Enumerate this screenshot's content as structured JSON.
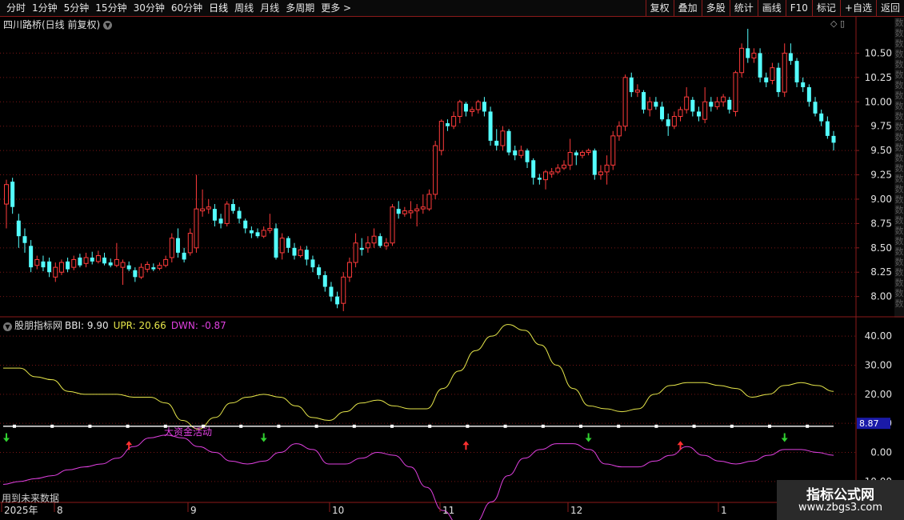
{
  "toolbar": {
    "periods": [
      "分时",
      "1分钟",
      "5分钟",
      "15分钟",
      "30分钟",
      "60分钟",
      "日线",
      "周线",
      "月线",
      "多周期",
      "更多 >"
    ],
    "active_period": "日线",
    "buttons": [
      "复权",
      "叠加",
      "多股",
      "统计",
      "画线",
      "F10",
      "标记",
      "+自选",
      "返回"
    ]
  },
  "chart": {
    "title": "四川路桥(日线 前复权)",
    "price_ticks": [
      "10.50",
      "10.25",
      "10.00",
      "9.75",
      "9.50",
      "9.25",
      "9.00",
      "8.75",
      "8.50",
      "8.25",
      "8.00"
    ],
    "price_range": [
      7.8,
      10.75
    ]
  },
  "indicator": {
    "name": "股朋指标网",
    "bbi_label": "BBI: 9.90",
    "upr_label": "UPR: 20.66",
    "dwn_label": "DWN: -0.87",
    "ticks": [
      "40.00",
      "30.00",
      "20.00",
      "10.00",
      "0.00",
      "-10.00"
    ],
    "range": [
      -15,
      45
    ],
    "current_value": "8.87",
    "annotation": "大资金活动",
    "colors": {
      "upr": "#e6e64a",
      "dwn": "#e040e0",
      "bbi": "#ffffff",
      "up_arrow": "#ff3030",
      "down_arrow": "#30d030"
    }
  },
  "time_axis": [
    "2025年",
    "8",
    "9",
    "10",
    "11",
    "12",
    "1"
  ],
  "bottom_note": "用到未来数据",
  "watermark": {
    "line1": "指标公式网",
    "line2": "www.zbgs3.com"
  },
  "candles": [
    {
      "o": 8.95,
      "c": 9.15,
      "h": 9.2,
      "l": 8.7
    },
    {
      "o": 9.18,
      "c": 8.92,
      "h": 9.22,
      "l": 8.85
    },
    {
      "o": 8.78,
      "c": 8.62,
      "h": 8.85,
      "l": 8.5
    },
    {
      "o": 8.62,
      "c": 8.55,
      "h": 8.7,
      "l": 8.45
    },
    {
      "o": 8.52,
      "c": 8.3,
      "h": 8.58,
      "l": 8.25
    },
    {
      "o": 8.32,
      "c": 8.38,
      "h": 8.42,
      "l": 8.28
    },
    {
      "o": 8.36,
      "c": 8.3,
      "h": 8.42,
      "l": 8.26
    },
    {
      "o": 8.36,
      "c": 8.25,
      "h": 8.4,
      "l": 8.2
    },
    {
      "o": 8.2,
      "c": 8.3,
      "h": 8.35,
      "l": 8.15
    },
    {
      "o": 8.25,
      "c": 8.35,
      "h": 8.38,
      "l": 8.22
    },
    {
      "o": 8.36,
      "c": 8.28,
      "h": 8.4,
      "l": 8.25
    },
    {
      "o": 8.3,
      "c": 8.38,
      "h": 8.42,
      "l": 8.27
    },
    {
      "o": 8.4,
      "c": 8.32,
      "h": 8.44,
      "l": 8.3
    },
    {
      "o": 8.34,
      "c": 8.4,
      "h": 8.45,
      "l": 8.3
    },
    {
      "o": 8.4,
      "c": 8.36,
      "h": 8.46,
      "l": 8.33
    },
    {
      "o": 8.36,
      "c": 8.42,
      "h": 8.47,
      "l": 8.34
    },
    {
      "o": 8.4,
      "c": 8.34,
      "h": 8.45,
      "l": 8.32
    },
    {
      "o": 8.35,
      "c": 8.32,
      "h": 8.39,
      "l": 8.3
    },
    {
      "o": 8.32,
      "c": 8.38,
      "h": 8.55,
      "l": 8.3
    },
    {
      "o": 8.3,
      "c": 8.35,
      "h": 8.38,
      "l": 8.12
    },
    {
      "o": 8.32,
      "c": 8.28,
      "h": 8.36,
      "l": 8.26
    },
    {
      "o": 8.27,
      "c": 8.2,
      "h": 8.3,
      "l": 8.15
    },
    {
      "o": 8.2,
      "c": 8.3,
      "h": 8.34,
      "l": 8.18
    },
    {
      "o": 8.28,
      "c": 8.33,
      "h": 8.36,
      "l": 8.25
    },
    {
      "o": 8.3,
      "c": 8.28,
      "h": 8.34,
      "l": 8.26
    },
    {
      "o": 8.29,
      "c": 8.32,
      "h": 8.35,
      "l": 8.27
    },
    {
      "o": 8.32,
      "c": 8.38,
      "h": 8.42,
      "l": 8.3
    },
    {
      "o": 8.4,
      "c": 8.6,
      "h": 8.65,
      "l": 8.35
    },
    {
      "o": 8.6,
      "c": 8.45,
      "h": 8.7,
      "l": 8.4
    },
    {
      "o": 8.45,
      "c": 8.38,
      "h": 8.5,
      "l": 8.35
    },
    {
      "o": 8.45,
      "c": 8.65,
      "h": 8.7,
      "l": 8.42
    },
    {
      "o": 8.5,
      "c": 8.9,
      "h": 9.25,
      "l": 8.45
    },
    {
      "o": 8.88,
      "c": 8.9,
      "h": 9.1,
      "l": 8.82
    },
    {
      "o": 8.9,
      "c": 8.92,
      "h": 9.0,
      "l": 8.85
    },
    {
      "o": 8.9,
      "c": 8.78,
      "h": 8.95,
      "l": 8.72
    },
    {
      "o": 8.8,
      "c": 8.75,
      "h": 8.85,
      "l": 8.7
    },
    {
      "o": 8.75,
      "c": 8.95,
      "h": 8.98,
      "l": 8.72
    },
    {
      "o": 8.95,
      "c": 8.88,
      "h": 9.0,
      "l": 8.85
    },
    {
      "o": 8.88,
      "c": 8.8,
      "h": 8.92,
      "l": 8.75
    },
    {
      "o": 8.78,
      "c": 8.7,
      "h": 8.8,
      "l": 8.65
    },
    {
      "o": 8.68,
      "c": 8.65,
      "h": 8.72,
      "l": 8.6
    },
    {
      "o": 8.66,
      "c": 8.62,
      "h": 8.7,
      "l": 8.6
    },
    {
      "o": 8.62,
      "c": 8.68,
      "h": 8.72,
      "l": 8.6
    },
    {
      "o": 8.68,
      "c": 8.7,
      "h": 8.85,
      "l": 8.65
    },
    {
      "o": 8.7,
      "c": 8.4,
      "h": 8.75,
      "l": 8.38
    },
    {
      "o": 8.45,
      "c": 8.6,
      "h": 8.65,
      "l": 8.38
    },
    {
      "o": 8.6,
      "c": 8.5,
      "h": 8.62,
      "l": 8.45
    },
    {
      "o": 8.5,
      "c": 8.42,
      "h": 8.55,
      "l": 8.38
    },
    {
      "o": 8.42,
      "c": 8.48,
      "h": 8.52,
      "l": 8.4
    },
    {
      "o": 8.48,
      "c": 8.38,
      "h": 8.52,
      "l": 8.32
    },
    {
      "o": 8.38,
      "c": 8.3,
      "h": 8.42,
      "l": 8.25
    },
    {
      "o": 8.3,
      "c": 8.22,
      "h": 8.33,
      "l": 8.18
    },
    {
      "o": 8.22,
      "c": 8.1,
      "h": 8.26,
      "l": 8.05
    },
    {
      "o": 8.1,
      "c": 8.0,
      "h": 8.15,
      "l": 7.95
    },
    {
      "o": 8.0,
      "c": 7.92,
      "h": 8.05,
      "l": 7.88
    },
    {
      "o": 7.93,
      "c": 8.2,
      "h": 8.25,
      "l": 7.85
    },
    {
      "o": 8.2,
      "c": 8.35,
      "h": 8.4,
      "l": 8.15
    },
    {
      "o": 8.35,
      "c": 8.55,
      "h": 8.65,
      "l": 8.3
    },
    {
      "o": 8.5,
      "c": 8.48,
      "h": 8.6,
      "l": 8.42
    },
    {
      "o": 8.5,
      "c": 8.55,
      "h": 8.62,
      "l": 8.45
    },
    {
      "o": 8.55,
      "c": 8.62,
      "h": 8.7,
      "l": 8.5
    },
    {
      "o": 8.62,
      "c": 8.52,
      "h": 8.65,
      "l": 8.5
    },
    {
      "o": 8.52,
      "c": 8.55,
      "h": 8.6,
      "l": 8.48
    },
    {
      "o": 8.55,
      "c": 8.92,
      "h": 8.95,
      "l": 8.52
    },
    {
      "o": 8.9,
      "c": 8.85,
      "h": 8.98,
      "l": 8.8
    },
    {
      "o": 8.85,
      "c": 8.88,
      "h": 8.92,
      "l": 8.82
    },
    {
      "o": 8.86,
      "c": 8.88,
      "h": 8.98,
      "l": 8.8
    },
    {
      "o": 8.88,
      "c": 8.9,
      "h": 8.95,
      "l": 8.72
    },
    {
      "o": 8.9,
      "c": 8.92,
      "h": 9.05,
      "l": 8.85
    },
    {
      "o": 8.9,
      "c": 9.05,
      "h": 9.1,
      "l": 8.88
    },
    {
      "o": 9.05,
      "c": 9.55,
      "h": 9.6,
      "l": 9.0
    },
    {
      "o": 9.5,
      "c": 9.8,
      "h": 9.82,
      "l": 9.45
    },
    {
      "o": 9.78,
      "c": 9.75,
      "h": 9.82,
      "l": 9.7
    },
    {
      "o": 9.75,
      "c": 9.85,
      "h": 9.9,
      "l": 9.72
    },
    {
      "o": 9.85,
      "c": 10.0,
      "h": 10.02,
      "l": 9.78
    },
    {
      "o": 9.98,
      "c": 9.9,
      "h": 10.0,
      "l": 9.85
    },
    {
      "o": 9.9,
      "c": 9.92,
      "h": 9.95,
      "l": 9.85
    },
    {
      "o": 9.92,
      "c": 10.0,
      "h": 10.02,
      "l": 9.88
    },
    {
      "o": 10.0,
      "c": 9.9,
      "h": 10.05,
      "l": 9.85
    },
    {
      "o": 9.9,
      "c": 9.6,
      "h": 9.95,
      "l": 9.55
    },
    {
      "o": 9.6,
      "c": 9.55,
      "h": 9.72,
      "l": 9.5
    },
    {
      "o": 9.55,
      "c": 9.7,
      "h": 9.75,
      "l": 9.5
    },
    {
      "o": 9.7,
      "c": 9.48,
      "h": 9.72,
      "l": 9.45
    },
    {
      "o": 9.5,
      "c": 9.45,
      "h": 9.55,
      "l": 9.4
    },
    {
      "o": 9.45,
      "c": 9.5,
      "h": 9.55,
      "l": 9.42
    },
    {
      "o": 9.5,
      "c": 9.38,
      "h": 9.52,
      "l": 9.32
    },
    {
      "o": 9.4,
      "c": 9.22,
      "h": 9.42,
      "l": 9.15
    },
    {
      "o": 9.22,
      "c": 9.2,
      "h": 9.26,
      "l": 9.15
    },
    {
      "o": 9.2,
      "c": 9.28,
      "h": 9.3,
      "l": 9.1
    },
    {
      "o": 9.26,
      "c": 9.28,
      "h": 9.32,
      "l": 9.22
    },
    {
      "o": 9.28,
      "c": 9.32,
      "h": 9.36,
      "l": 9.26
    },
    {
      "o": 9.32,
      "c": 9.35,
      "h": 9.4,
      "l": 9.3
    },
    {
      "o": 9.35,
      "c": 9.48,
      "h": 9.62,
      "l": 9.3
    },
    {
      "o": 9.48,
      "c": 9.45,
      "h": 9.5,
      "l": 9.35
    },
    {
      "o": 9.45,
      "c": 9.48,
      "h": 9.5,
      "l": 9.42
    },
    {
      "o": 9.48,
      "c": 9.5,
      "h": 9.52,
      "l": 9.45
    },
    {
      "o": 9.5,
      "c": 9.25,
      "h": 9.52,
      "l": 9.2
    },
    {
      "o": 9.25,
      "c": 9.28,
      "h": 9.35,
      "l": 9.2
    },
    {
      "o": 9.28,
      "c": 9.35,
      "h": 9.45,
      "l": 9.15
    },
    {
      "o": 9.35,
      "c": 9.65,
      "h": 9.7,
      "l": 9.3
    },
    {
      "o": 9.65,
      "c": 9.75,
      "h": 9.8,
      "l": 9.6
    },
    {
      "o": 9.75,
      "c": 10.25,
      "h": 10.28,
      "l": 9.7
    },
    {
      "o": 10.25,
      "c": 10.1,
      "h": 10.3,
      "l": 10.05
    },
    {
      "o": 10.1,
      "c": 10.12,
      "h": 10.18,
      "l": 10.05
    },
    {
      "o": 10.1,
      "c": 9.92,
      "h": 10.12,
      "l": 9.88
    },
    {
      "o": 9.92,
      "c": 10.0,
      "h": 10.05,
      "l": 9.85
    },
    {
      "o": 10.0,
      "c": 9.95,
      "h": 10.05,
      "l": 9.92
    },
    {
      "o": 9.95,
      "c": 9.82,
      "h": 10.0,
      "l": 9.8
    },
    {
      "o": 9.82,
      "c": 9.75,
      "h": 9.88,
      "l": 9.65
    },
    {
      "o": 9.75,
      "c": 9.85,
      "h": 9.9,
      "l": 9.72
    },
    {
      "o": 9.85,
      "c": 9.92,
      "h": 9.95,
      "l": 9.8
    },
    {
      "o": 9.92,
      "c": 10.05,
      "h": 10.15,
      "l": 9.88
    },
    {
      "o": 10.02,
      "c": 9.9,
      "h": 10.05,
      "l": 9.85
    },
    {
      "o": 9.9,
      "c": 9.85,
      "h": 9.95,
      "l": 9.8
    },
    {
      "o": 9.82,
      "c": 10.0,
      "h": 10.15,
      "l": 9.78
    },
    {
      "o": 10.0,
      "c": 9.95,
      "h": 10.05,
      "l": 9.9
    },
    {
      "o": 9.95,
      "c": 10.0,
      "h": 10.05,
      "l": 9.92
    },
    {
      "o": 10.0,
      "c": 10.05,
      "h": 10.08,
      "l": 9.95
    },
    {
      "o": 10.02,
      "c": 9.92,
      "h": 10.05,
      "l": 9.88
    },
    {
      "o": 9.9,
      "c": 10.3,
      "h": 10.32,
      "l": 9.85
    },
    {
      "o": 10.3,
      "c": 10.55,
      "h": 10.6,
      "l": 10.25
    },
    {
      "o": 10.55,
      "c": 10.45,
      "h": 10.75,
      "l": 10.4
    },
    {
      "o": 10.45,
      "c": 10.5,
      "h": 10.55,
      "l": 10.4
    },
    {
      "o": 10.5,
      "c": 10.25,
      "h": 10.55,
      "l": 10.2
    },
    {
      "o": 10.25,
      "c": 10.2,
      "h": 10.3,
      "l": 10.15
    },
    {
      "o": 10.22,
      "c": 10.35,
      "h": 10.4,
      "l": 10.18
    },
    {
      "o": 10.35,
      "c": 10.1,
      "h": 10.4,
      "l": 10.05
    },
    {
      "o": 10.1,
      "c": 10.5,
      "h": 10.6,
      "l": 10.05
    },
    {
      "o": 10.5,
      "c": 10.42,
      "h": 10.6,
      "l": 10.38
    },
    {
      "o": 10.42,
      "c": 10.2,
      "h": 10.45,
      "l": 10.15
    },
    {
      "o": 10.2,
      "c": 10.15,
      "h": 10.25,
      "l": 10.1
    },
    {
      "o": 10.15,
      "c": 10.0,
      "h": 10.18,
      "l": 9.95
    },
    {
      "o": 10.0,
      "c": 9.88,
      "h": 10.05,
      "l": 9.85
    },
    {
      "o": 9.88,
      "c": 9.8,
      "h": 9.92,
      "l": 9.75
    },
    {
      "o": 9.8,
      "c": 9.65,
      "h": 9.85,
      "l": 9.62
    },
    {
      "o": 9.65,
      "c": 9.58,
      "h": 9.7,
      "l": 9.5
    }
  ],
  "series": {
    "upr": [
      29,
      29,
      26,
      25,
      21,
      20,
      20,
      20,
      19,
      19,
      17,
      11,
      8,
      12,
      17,
      19,
      20,
      19,
      16,
      12,
      11,
      14,
      17,
      18,
      16,
      15,
      15,
      22,
      28,
      35,
      40,
      44,
      42,
      37,
      30,
      22,
      16,
      15,
      14,
      15,
      20,
      23,
      24,
      24,
      23,
      22,
      19,
      20,
      23,
      24,
      23,
      21
    ],
    "dwn": [
      -11,
      -10,
      -9,
      -8,
      -6,
      -5,
      -4,
      -2,
      2,
      5,
      6,
      5,
      2,
      0,
      -3,
      -4,
      -3,
      0,
      3,
      1,
      -4,
      -4,
      -2,
      0,
      -1,
      -5,
      -12,
      -20,
      -25,
      -24,
      -17,
      -8,
      -2,
      1,
      3,
      3,
      1,
      -4,
      -5,
      -5,
      -3,
      -1,
      2,
      -1,
      -3,
      -4,
      -3,
      -1,
      1,
      1,
      0,
      -1
    ],
    "bbi": [
      9.0,
      9.0,
      9.0,
      9.0,
      9.0,
      9.0,
      9.0,
      9.0,
      9.0,
      9.0,
      9.0,
      9.0,
      9.0,
      9.0,
      9.0,
      9.0,
      9.0,
      9.0,
      9.0,
      9.0,
      9.0,
      9.0,
      9.0,
      9.0,
      9.0,
      9.0,
      9.0,
      9.0,
      9.0,
      9.0,
      9.0,
      9.0,
      9.0,
      9.0,
      9.0,
      9.0,
      9.0,
      9.0,
      9.0,
      9.0,
      9.0,
      9.0,
      9.0,
      9.0,
      9.0,
      9.0,
      9.0,
      9.0,
      9.0,
      9.0,
      9.0,
      9.0
    ]
  },
  "arrows": [
    {
      "idx": 0,
      "dir": "down"
    },
    {
      "idx": 20,
      "dir": "up"
    },
    {
      "idx": 42,
      "dir": "down"
    },
    {
      "idx": 75,
      "dir": "up"
    },
    {
      "idx": 95,
      "dir": "down"
    },
    {
      "idx": 110,
      "dir": "up"
    },
    {
      "idx": 127,
      "dir": "down"
    }
  ]
}
